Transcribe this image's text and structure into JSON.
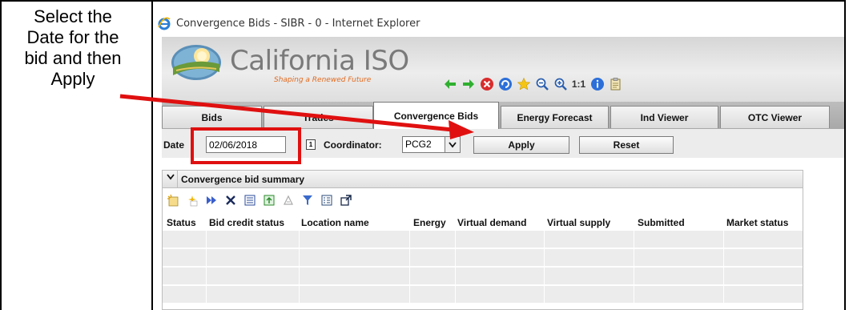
{
  "callout": {
    "text": "Select the\nDate for the\nbid and then\nApply"
  },
  "window": {
    "title": "Convergence Bids - SIBR - 0 - Internet Explorer"
  },
  "brand": {
    "name": "California ISO",
    "tagline": "Shaping a Renewed Future"
  },
  "toolbar": {
    "icons": [
      "back-arrow-icon",
      "forward-arrow-icon",
      "stop-icon",
      "refresh-icon",
      "favorites-star-icon",
      "zoom-out-icon",
      "zoom-in-icon",
      "actual-size",
      "info-icon",
      "clipboard-icon"
    ],
    "actual_size_label": "1:1"
  },
  "tabs": [
    {
      "label": "Bids",
      "active": false
    },
    {
      "label": "Trades",
      "active": false
    },
    {
      "label": "Convergence Bids",
      "active": true
    },
    {
      "label": "Energy Forecast",
      "active": false
    },
    {
      "label": "Ind Viewer",
      "active": false
    },
    {
      "label": "OTC Viewer",
      "active": false
    }
  ],
  "filter": {
    "date_label": "Date",
    "date_value": "02/06/2018",
    "calendar_icon_text": "1",
    "coordinator_label": "Coordinator:",
    "coordinator_value": "PCG2",
    "apply_label": "Apply",
    "reset_label": "Reset"
  },
  "panel": {
    "title": "Convergence bid summary",
    "tools": [
      "new-bid-icon",
      "copy-bid-icon",
      "submit-icon",
      "delete-icon",
      "view-icon",
      "export-icon",
      "clear-icon",
      "filter-icon",
      "column-chooser-icon",
      "popout-icon"
    ],
    "columns": [
      "Status",
      "Bid credit status",
      "Location name",
      "Energy",
      "Virtual demand",
      "Virtual supply",
      "Submitted",
      "Market status"
    ],
    "rows": []
  },
  "colors": {
    "annotation_red": "#e01010",
    "logo_orange": "#e26a1e",
    "logo_gray": "#7a7a7a"
  }
}
